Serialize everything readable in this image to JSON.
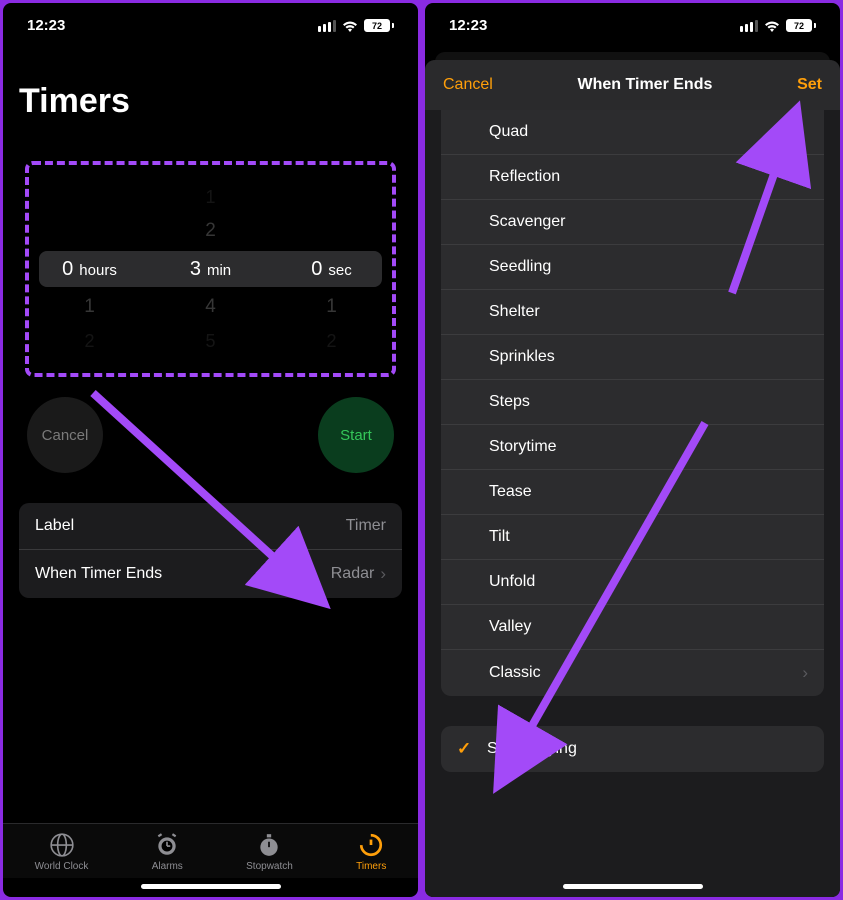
{
  "status": {
    "time": "12:23",
    "battery": "72"
  },
  "left": {
    "title": "Timers",
    "picker": {
      "hours": {
        "value": "0",
        "unit": "hours",
        "below1": "1",
        "below2": "2"
      },
      "min": {
        "above2": "1",
        "above1": "2",
        "value": "3",
        "unit": "min",
        "below1": "4",
        "below2": "5"
      },
      "sec": {
        "value": "0",
        "unit": "sec",
        "below1": "1",
        "below2": "2"
      }
    },
    "cancel": "Cancel",
    "start": "Start",
    "rows": {
      "label_key": "Label",
      "label_value": "Timer",
      "ends_key": "When Timer Ends",
      "ends_value": "Radar"
    },
    "tabs": {
      "world": "World Clock",
      "alarms": "Alarms",
      "stopwatch": "Stopwatch",
      "timers": "Timers"
    }
  },
  "right": {
    "cancel": "Cancel",
    "title": "When Timer Ends",
    "set": "Set",
    "sounds": [
      "Quad",
      "Reflection",
      "Scavenger",
      "Seedling",
      "Shelter",
      "Sprinkles",
      "Steps",
      "Storytime",
      "Tease",
      "Tilt",
      "Unfold",
      "Valley",
      "Classic"
    ],
    "stop": "Stop Playing"
  }
}
